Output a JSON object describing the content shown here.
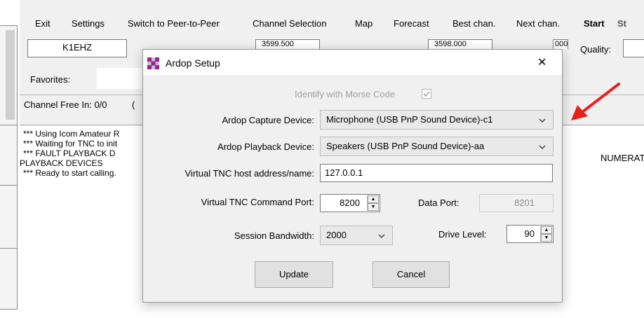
{
  "menu": [
    {
      "label": "Exit"
    },
    {
      "label": "Settings"
    },
    {
      "label": "Switch to Peer-to-Peer"
    },
    {
      "label": "Channel Selection"
    },
    {
      "label": "Map"
    },
    {
      "label": "Forecast"
    },
    {
      "label": "Best chan."
    },
    {
      "label": "Next chan."
    },
    {
      "label": "Start"
    },
    {
      "label": "St"
    }
  ],
  "main": {
    "callsign": "K1EHZ",
    "center_freq_partial": "3599.500",
    "dial_freq_partial": "3598.000",
    "spin_partial": "000",
    "quality_label": "Quality:",
    "favorites_label": "Favorites:",
    "channel_status": "Channel Free  In: 0/0",
    "channel_status_suffix": "(",
    "log": [
      "*** Using Icom Amateur R",
      "*** Waiting for TNC to init",
      "*** FAULT PLAYBACK D",
      "PLAYBACK DEVICES",
      "*** Ready to start calling."
    ],
    "log_right_fragment": "NUMERATE"
  },
  "dialog": {
    "title": "Ardop Setup",
    "close_glyph": "✕",
    "morse_label": "Identify with Morse Code",
    "morse_checked": true,
    "capture_label": "Ardop Capture Device:",
    "capture_value": "Microphone (USB PnP Sound Device)-c1",
    "playback_label": "Ardop Playback Device:",
    "playback_value": "Speakers (USB PnP Sound Device)-aa",
    "host_label": "Virtual TNC host address/name:",
    "host_value": "127.0.0.1",
    "cmd_port_label": "Virtual TNC Command Port:",
    "cmd_port_value": "8200",
    "data_port_label": "Data Port:",
    "data_port_value": "8201",
    "bandwidth_label": "Session Bandwidth:",
    "bandwidth_value": "2000",
    "drive_label": "Drive Level:",
    "drive_value": "90",
    "update_label": "Update",
    "cancel_label": "Cancel"
  },
  "icons": {
    "app_icon": "ardop-app-icon",
    "dropdown": "chevron-down-icon",
    "annotation": "red-arrow-icon"
  },
  "colors": {
    "annotation_arrow": "#e8201a",
    "app_icon_purple": "#8b2a8f",
    "disabled_text": "#a0a0a0"
  }
}
